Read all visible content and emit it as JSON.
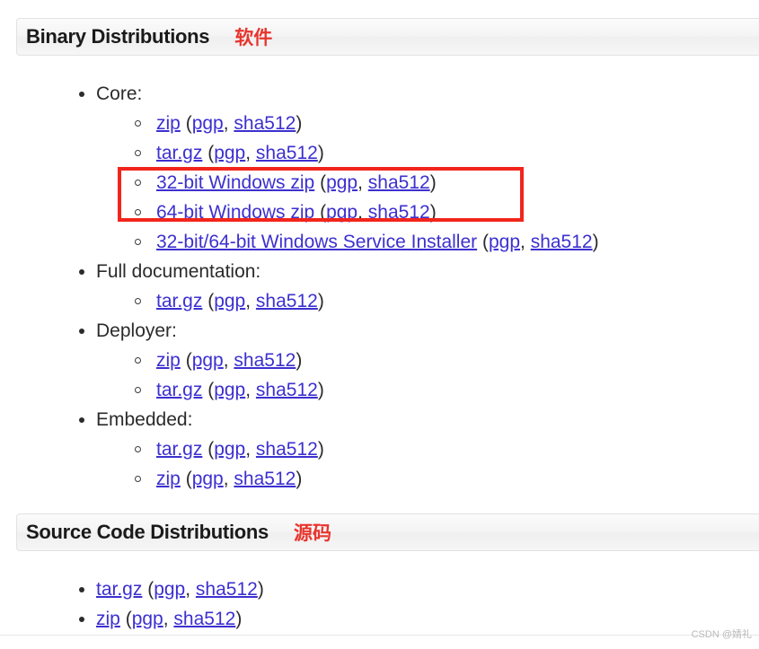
{
  "sections": [
    {
      "title": "Binary Distributions",
      "annotation": "软件",
      "annotation_color": "#e8352e"
    },
    {
      "title": "Source Code Distributions",
      "annotation": "源码",
      "annotation_color": "#e8352e"
    }
  ],
  "binary_groups": [
    {
      "label": "Core:",
      "items": [
        {
          "name": "zip",
          "pgp": "pgp",
          "hash": "sha512"
        },
        {
          "name": "tar.gz",
          "pgp": "pgp",
          "hash": "sha512"
        },
        {
          "name": "32-bit Windows zip",
          "pgp": "pgp",
          "hash": "sha512"
        },
        {
          "name": "64-bit Windows zip",
          "pgp": "pgp",
          "hash": "sha512"
        },
        {
          "name": "32-bit/64-bit Windows Service Installer",
          "pgp": "pgp",
          "hash": "sha512"
        }
      ]
    },
    {
      "label": "Full documentation:",
      "items": [
        {
          "name": "tar.gz",
          "pgp": "pgp",
          "hash": "sha512"
        }
      ]
    },
    {
      "label": "Deployer:",
      "items": [
        {
          "name": "zip",
          "pgp": "pgp",
          "hash": "sha512"
        },
        {
          "name": "tar.gz",
          "pgp": "pgp",
          "hash": "sha512"
        }
      ]
    },
    {
      "label": "Embedded:",
      "items": [
        {
          "name": "tar.gz",
          "pgp": "pgp",
          "hash": "sha512"
        },
        {
          "name": "zip",
          "pgp": "pgp",
          "hash": "sha512"
        }
      ]
    }
  ],
  "source_items": [
    {
      "name": "tar.gz",
      "pgp": "pgp",
      "hash": "sha512"
    },
    {
      "name": "zip",
      "pgp": "pgp",
      "hash": "sha512"
    }
  ],
  "punctuation": {
    "open_paren": " (",
    "comma": ", ",
    "close_paren": ")"
  },
  "highlight": {
    "color": "#f2251c",
    "targets": [
      "32-bit Windows zip",
      "64-bit Windows zip"
    ]
  },
  "watermark": "CSDN @婧礼",
  "link_color": "#3c30cf"
}
